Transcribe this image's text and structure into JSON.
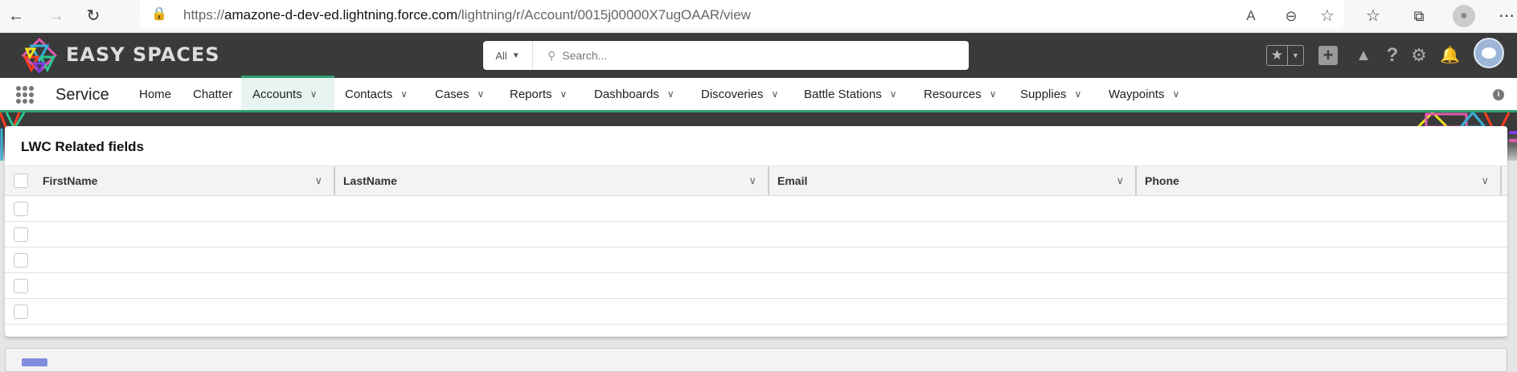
{
  "browser": {
    "url_prefix": "https://",
    "url_host": "amazone-d-dev-ed.lightning.force.com",
    "url_path": "/lightning/r/Account/0015j00000X7ugOAAR/view"
  },
  "header": {
    "app_logo_text": "EASY SPACES",
    "search_scope": "All",
    "search_placeholder": "Search..."
  },
  "nav": {
    "app_name": "Service",
    "items": [
      {
        "label": "Home",
        "dropdown": false
      },
      {
        "label": "Chatter",
        "dropdown": false
      },
      {
        "label": "Accounts",
        "dropdown": true,
        "active": true
      },
      {
        "label": "Contacts",
        "dropdown": true
      },
      {
        "label": "Cases",
        "dropdown": true
      },
      {
        "label": "Reports",
        "dropdown": true
      },
      {
        "label": "Dashboards",
        "dropdown": true
      },
      {
        "label": "Discoveries",
        "dropdown": true
      },
      {
        "label": "Battle Stations",
        "dropdown": true
      },
      {
        "label": "Resources",
        "dropdown": true
      },
      {
        "label": "Supplies",
        "dropdown": true
      },
      {
        "label": "Waypoints",
        "dropdown": true
      }
    ]
  },
  "card": {
    "title": "LWC Related fields",
    "columns": [
      "FirstName",
      "LastName",
      "Email",
      "Phone"
    ],
    "rows": [
      {},
      {},
      {},
      {},
      {}
    ]
  }
}
